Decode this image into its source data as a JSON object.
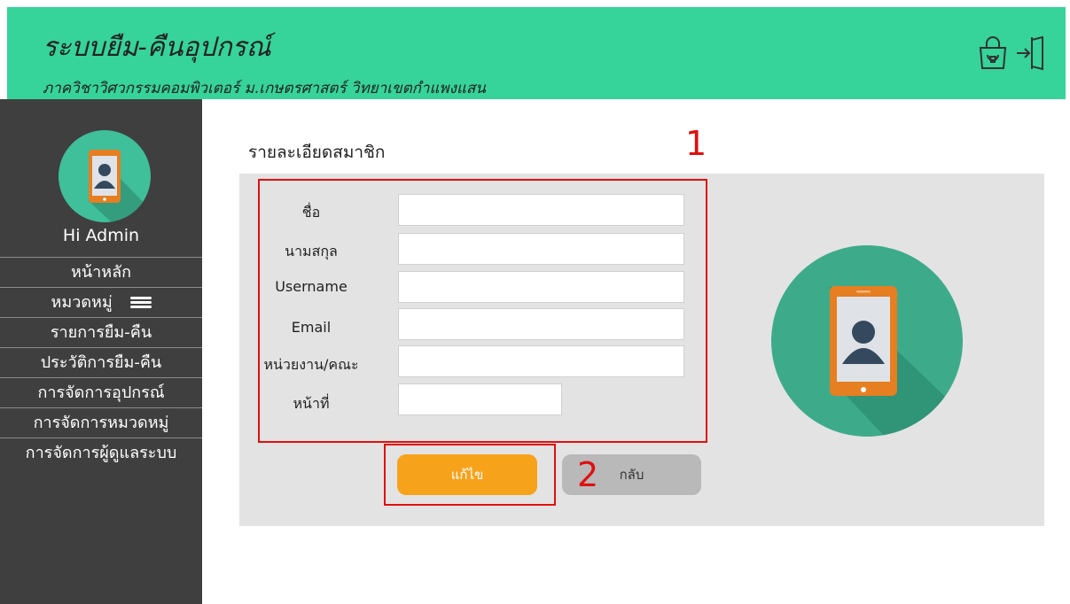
{
  "header": {
    "title": "ระบบยืม-คืนอุปกรณ์",
    "subtitle": "ภาควิชาวิศวกรรมคอมพิวเตอร์ ม.เกษตรศาสตร์ วิทยาเขตกำแพงแสน",
    "icons": [
      "shopping-bag-icon",
      "logout-icon"
    ]
  },
  "sidebar": {
    "greeting": "Hi Admin",
    "items": [
      {
        "label": "หน้าหลัก"
      },
      {
        "label": "หมวดหมู่"
      },
      {
        "label": "รายการยืม-คืน"
      },
      {
        "label": "ประวัติการยืม-คืน"
      },
      {
        "label": "การจัดการอุปกรณ์"
      },
      {
        "label": "การจัดการหมวดหมู่"
      },
      {
        "label": "การจัดการผู้ดูแลระบบ"
      }
    ]
  },
  "main": {
    "section_title": "รายละเอียดสมาชิก",
    "fields": [
      {
        "label": "ชื่อ",
        "value": ""
      },
      {
        "label": "นามสกุล",
        "value": ""
      },
      {
        "label": "Username",
        "value": ""
      },
      {
        "label": "Email",
        "value": ""
      },
      {
        "label": "หน่วยงาน/คณะ",
        "value": ""
      },
      {
        "label": "หน้าที่",
        "value": ""
      }
    ],
    "edit_button": "แก้ไข",
    "back_button": "กลับ"
  },
  "annotations": {
    "one": "1",
    "two": "2"
  },
  "colors": {
    "header": "#36d39a",
    "sidebar": "#3f3f3f",
    "edit": "#f7a21b",
    "back": "#b9b9b9",
    "annotation": "#e01010"
  }
}
